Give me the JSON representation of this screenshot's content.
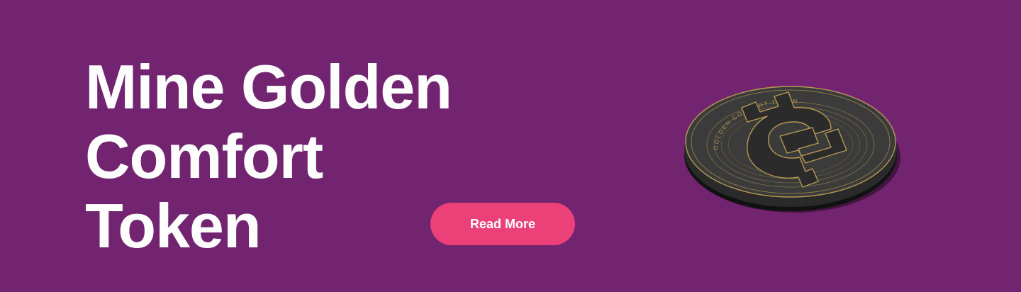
{
  "hero": {
    "title_lines": [
      "Mine Golden",
      "Comfort",
      "Token"
    ],
    "cta_label": "Read More",
    "coin_image": "golden-comfort-token-coin",
    "coin_engraving": "GOLDEN COMFORT TOKEN"
  },
  "colors": {
    "background": "#722470",
    "cta_background": "#ec4079",
    "title_text": "#ffffff",
    "coin_body": "#3a3a3a",
    "coin_gold": "#b79a52"
  }
}
